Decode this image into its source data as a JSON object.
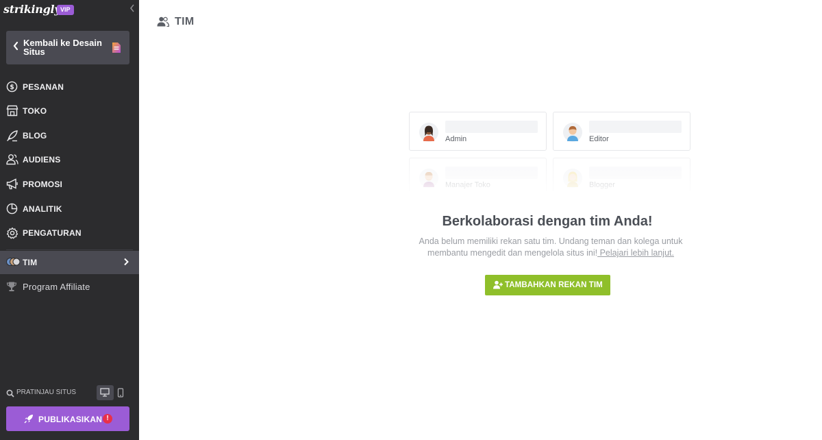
{
  "app": {
    "logo": "strikingly",
    "badge": "VIP"
  },
  "sidebar": {
    "back_button": "Kembali ke Desain Situs",
    "items": [
      {
        "label": "PESANAN",
        "icon": "dollar-circle-icon"
      },
      {
        "label": "TOKO",
        "icon": "store-icon"
      },
      {
        "label": "BLOG",
        "icon": "quill-icon"
      },
      {
        "label": "AUDIENS",
        "icon": "audience-icon"
      },
      {
        "label": "PROMOSI",
        "icon": "megaphone-icon"
      },
      {
        "label": "ANALITIK",
        "icon": "pie-chart-icon"
      },
      {
        "label": "PENGATURAN",
        "icon": "gear-icon"
      },
      {
        "label": "TIM",
        "icon": "team-avatars-icon",
        "active": true
      },
      {
        "label": "Program Affiliate",
        "icon": "trophy-icon"
      }
    ],
    "preview_label": "PRATINJAU SITUS",
    "publish_label": "PUBLIKASIKAN",
    "publish_alert": "!"
  },
  "main": {
    "title": "TIM",
    "roles": [
      {
        "name": "Admin"
      },
      {
        "name": "Editor"
      },
      {
        "name": "Manajer Toko"
      },
      {
        "name": "Blogger"
      }
    ],
    "empty_title": "Berkolaborasi dengan tim Anda!",
    "empty_desc": "Anda belum memiliki rekan satu tim. Undang teman dan kolega untuk membantu mengedit dan mengelola situs ini!",
    "learn_more": " Pelajari lebih lanjut.",
    "add_button": "TAMBAHKAN REKAN TIM"
  },
  "colors": {
    "sidebar_bg": "#2c2c2e",
    "accent_purple": "#9b5cd6",
    "accent_green": "#8fbf2a",
    "alert_red": "#e8304a"
  }
}
